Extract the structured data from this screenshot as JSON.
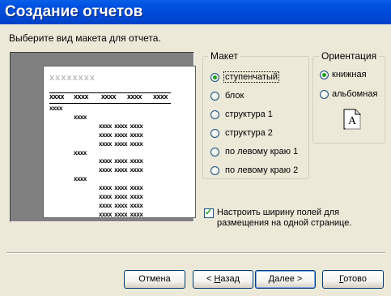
{
  "window": {
    "title": "Создание отчетов"
  },
  "prompt": "Выберите вид макета для отчета.",
  "preview": {
    "title_placeholder": "xxxxxxxx",
    "header_fields": [
      "xxxx",
      "xxxx",
      "xxxx",
      "xxxx",
      "xxxx"
    ],
    "rows": [
      {
        "level": 0,
        "text": "xxxx"
      },
      {
        "level": 1,
        "text": "xxxx"
      },
      {
        "level": 2,
        "text": "xxxx  xxxx  xxxx"
      },
      {
        "level": 2,
        "text": "xxxx  xxxx  xxxx"
      },
      {
        "level": 2,
        "text": "xxxx  xxxx  xxxx"
      },
      {
        "level": 1,
        "text": "xxxx"
      },
      {
        "level": 2,
        "text": "xxxx  xxxx  xxxx"
      },
      {
        "level": 2,
        "text": "xxxx  xxxx  xxxx"
      },
      {
        "level": 1,
        "text": "xxxx"
      },
      {
        "level": 2,
        "text": "xxxx  xxxx  xxxx"
      },
      {
        "level": 2,
        "text": "xxxx  xxxx  xxxx"
      },
      {
        "level": 2,
        "text": "xxxx  xxxx  xxxx"
      },
      {
        "level": 2,
        "text": "xxxx  xxxx  xxxx"
      }
    ]
  },
  "layout_group": {
    "label": "Макет",
    "options": [
      {
        "label": "ступенчатый",
        "selected": true
      },
      {
        "label": "блок",
        "selected": false
      },
      {
        "label": "структура 1",
        "selected": false
      },
      {
        "label": "структура 2",
        "selected": false
      },
      {
        "label": "по левому краю 1",
        "selected": false
      },
      {
        "label": "по левому краю 2",
        "selected": false
      }
    ]
  },
  "orientation_group": {
    "label": "Ориентация",
    "options": [
      {
        "label": "книжная",
        "selected": true
      },
      {
        "label": "альбомная",
        "selected": false
      }
    ],
    "page_icon_letter": "A"
  },
  "fit_checkbox": {
    "checked": true,
    "label": "Настроить ширину полей для размещения на одной странице."
  },
  "buttons": {
    "cancel": "Отмена",
    "back": "< Назад",
    "next": "Далее >",
    "finish": "Готово"
  }
}
